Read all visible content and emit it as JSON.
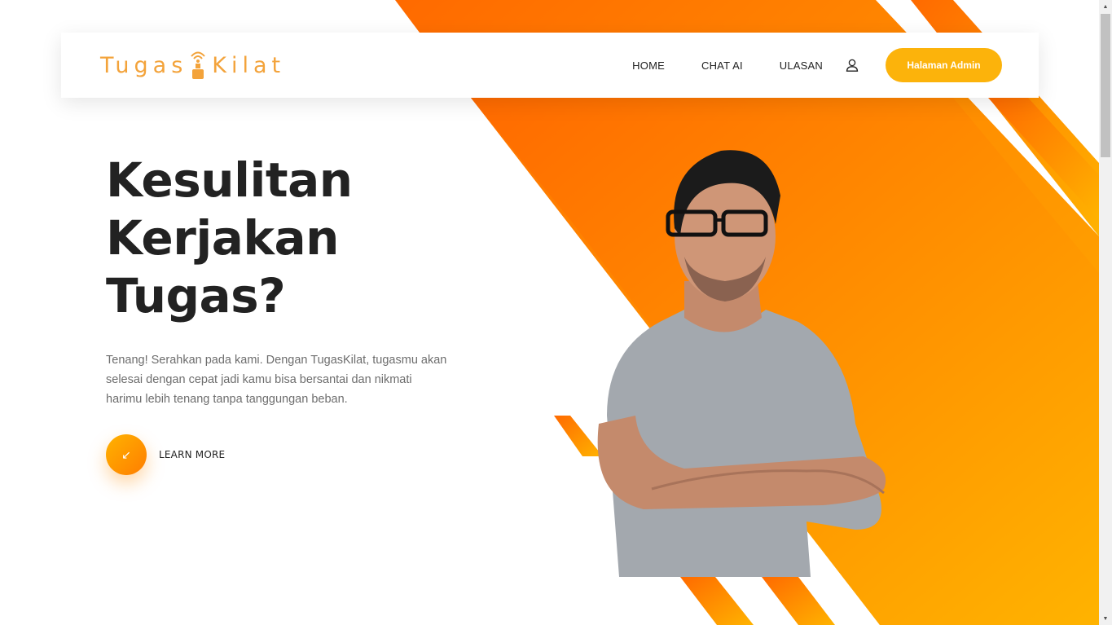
{
  "brand": {
    "name_left": "Tugas",
    "name_right": "Kilat",
    "color": "#f3a33b",
    "icon": "wifi-tower-icon"
  },
  "nav": {
    "links": [
      "HOME",
      "CHAT AI",
      "ULASAN"
    ],
    "user_icon": "user-icon",
    "admin_button": "Halaman Admin",
    "admin_button_color": "#fcb30b"
  },
  "hero": {
    "title_lines": [
      "Kesulitan",
      "Kerjakan",
      "Tugas?"
    ],
    "description": "Tenang! Serahkan pada kami. Dengan TugasKilat, tugasmu akan selesai dengan cepat jadi kamu bisa bersantai dan nikmati harimu lebih tenang tanpa tanggungan beban.",
    "cta_icon": "arrow-down-left-icon",
    "cta_label": "LEARN MORE"
  },
  "theme": {
    "accent_orange": "#ff7300",
    "accent_yellow": "#ffb300",
    "text_dark": "#222222",
    "text_muted": "#6d6d6d"
  }
}
